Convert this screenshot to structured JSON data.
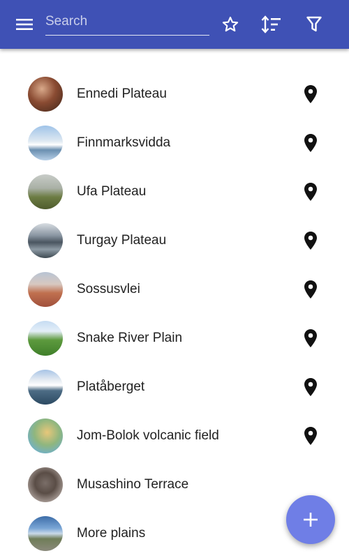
{
  "colors": {
    "app_bar": "#3f51b5",
    "fab": "#6f7ee6",
    "text": "#222222"
  },
  "app_bar": {
    "menu_icon": "menu-icon",
    "search": {
      "placeholder": "Search",
      "value": ""
    },
    "actions": [
      {
        "name": "favorites",
        "icon": "star-outline-icon"
      },
      {
        "name": "sort",
        "icon": "sort-icon"
      },
      {
        "name": "filter",
        "icon": "filter-icon"
      }
    ]
  },
  "list": {
    "items": [
      {
        "label": "Ennedi Plateau",
        "has_location": true
      },
      {
        "label": "Finnmarksvidda",
        "has_location": true
      },
      {
        "label": "Ufa Plateau",
        "has_location": true
      },
      {
        "label": "Turgay Plateau",
        "has_location": true
      },
      {
        "label": "Sossusvlei",
        "has_location": true
      },
      {
        "label": "Snake River Plain",
        "has_location": true
      },
      {
        "label": "Platåberget",
        "has_location": true
      },
      {
        "label": "Jom-Bolok volcanic field",
        "has_location": true
      },
      {
        "label": "Musashino Terrace",
        "has_location": false
      },
      {
        "label": "More plains",
        "has_location": false
      }
    ]
  },
  "fab": {
    "icon": "plus-icon"
  }
}
